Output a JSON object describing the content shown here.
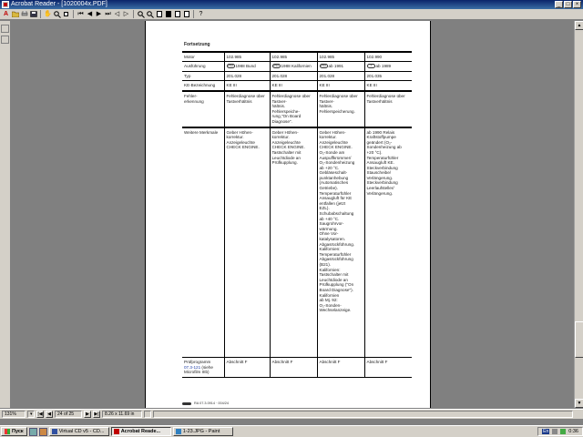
{
  "window": {
    "title": "Acrobat Reader - [1020004x.PDF]",
    "controls": [
      "_",
      "□",
      "×"
    ]
  },
  "toolbar": {
    "icons": [
      "menu-logo-icon",
      "open-icon",
      "print-icon",
      "save-icon",
      "hand-icon",
      "zoom-icon",
      "select-text-icon",
      "first-page-icon",
      "prev-page-icon",
      "next-page-icon",
      "last-page-icon",
      "back-icon",
      "forward-icon",
      "actual-size-icon",
      "fit-page-icon",
      "fit-width-icon",
      "find-icon",
      "help-icon"
    ],
    "help_label": "?"
  },
  "document": {
    "section_title": "Fortsetzung",
    "rows": [
      {
        "label": "Motor",
        "cells": [
          "102.985",
          "102.985",
          "102.985",
          "102.990"
        ]
      },
      {
        "label": "Ausführung",
        "cells": [
          "1988 Bund",
          "1988 Kalifornien",
          "ab 1991",
          "ab 1989"
        ],
        "badges": [
          "USA",
          "USA",
          "USA",
          "J"
        ]
      },
      {
        "label": "Typ",
        "cells": [
          "201.028",
          "201.028",
          "201.028",
          "201.035"
        ]
      },
      {
        "label": "KE-Bezeichnung",
        "cells": [
          "KE III",
          "KE III",
          "KE III",
          "KE III"
        ]
      },
      {
        "label": "Fehler-\nerkennung",
        "cells": [
          "Fehlerdiagnose über Tastverhältnis",
          "Fehlerdiagnose über Tastver-\nhältnis.\nFehlerspeiche-\nrung,\"On Board Diagnose\".",
          "Fehlerdiagnose über Tastver-\nhältnis.\nFehlerspeicherung.",
          "Fehlerdiagnose über Tastverhältnis"
        ]
      },
      {
        "label": "Weitere Merkmale",
        "cells": [
          "Geber Höhen-\nkorrektur.\nAnzeigeleuchte\nCHECK ENGINE.",
          "Geber Höhen-\nkorrektur.\nAnzeigeleuchte\nCHECK ENGINE.\nTastschalter mit\nLeuchtdiode an\nPrüfkupplung.",
          "Geber Höhen-\nkorrektur.\nAnzeigeleuchte\nCHECK ENGINE.\nO₂-Sonde am\nAuspuffkrümmer/\nO₂-Sondenheizung\nab +20 °C.\nGebläseschalt-\npunktanhebung\n(Automatisches\nGetriebe).\nTemperaturfühler\nAnsaugluft für KE\nentfallen (jetzt\nEZL).\nSchubabschaltung\nab +40 °C.\nSaugrohrvor-\nwärmung.\nOhne Vor-\nkatalysatoren.\nAbgasrückführung.\nKalifornien:\nTemperaturfühler\nAbgasrückführung\n(B21).\nKalifornien:\nTastschalter mit\nLeuchtdiode an\nPrüfkupplung (\"On\nBoard Diagnose\").\nKalifornien\nab Mj. 92:\nO₂-Sonden-\nWechselanzeige.",
          "ab 1990 Relais\nKraftstoffpumpe\ngeändert (O₂-\nSondenheizung ab\n+20 °C).\nTemperaturfühler\nAnsaugluft KE.\nSteckverbindung\nStauscheibe/\nVerlängerung.\nSteckverbindung\nLeerlaufsteller/\nVerlängerung."
        ]
      },
      {
        "label_prefix": "Prüfprogramm",
        "label_link": "07.3-121",
        "label_suffix": "(siehe Microfilm IIIb)",
        "cells": [
          "Abschnitt F",
          "Abschnitt F",
          "Abschnitt F",
          "Abschnitt F"
        ]
      }
    ],
    "footer_text": "RA 07.3.0914 · 004/24"
  },
  "statusbar": {
    "zoom": "131%",
    "page": "24 of 25",
    "page_size": "8.26 x 11.69 in",
    "nav": [
      "|◀",
      "◀",
      "▶",
      "▶|"
    ]
  },
  "taskbar": {
    "start_label": "Пуск",
    "tasks": [
      {
        "label": "Virtual CD v5 - CD...",
        "active": false,
        "color": "#3050a0"
      },
      {
        "label": "Acrobat Reade...",
        "active": true,
        "color": "#c00000"
      },
      {
        "label": "1-23.JPG - Paint",
        "active": false,
        "color": "#3080c0"
      }
    ],
    "language": "En",
    "clock": "0:36"
  },
  "colors": {
    "titlebar": "#0a246a",
    "link": "#1f3ea5",
    "chrome": "#d4d0c8",
    "workspace": "#808080"
  }
}
